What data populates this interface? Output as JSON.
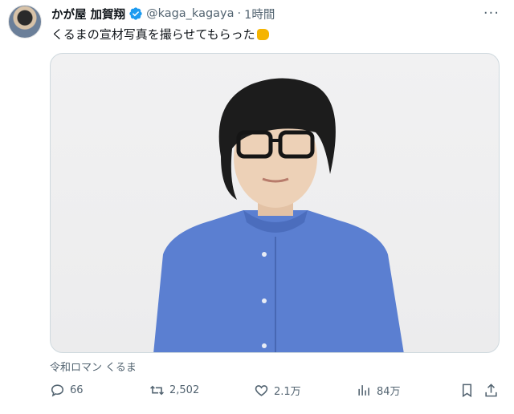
{
  "tweet": {
    "display_name": "かが屋 加賀翔",
    "handle": "@kaga_kagaya",
    "separator": "·",
    "time": "1時間",
    "text": "くるまの宣材写真を撮らせてもらった",
    "emoji": "fist-emoji",
    "media_caption": "令和ロマン くるま"
  },
  "actions": {
    "replies": "66",
    "retweets": "2,502",
    "likes": "2.1万",
    "views": "84万"
  },
  "colors": {
    "verified": "#1d9bf0",
    "shirt": "#5b7fd1",
    "text_secondary": "#536471"
  }
}
